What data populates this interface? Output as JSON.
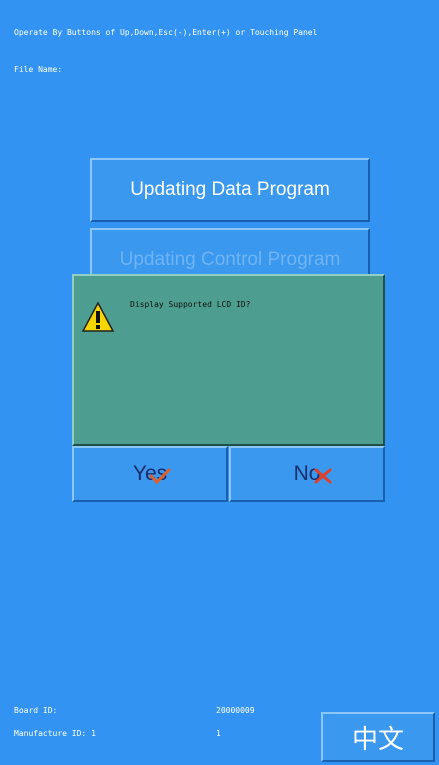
{
  "header": {
    "instruction": "Operate By Buttons of Up,Down,Esc(-),Enter(+) or Touching Panel",
    "file_name_label": "File Name:"
  },
  "menu": {
    "items": [
      {
        "label": "Updating Data Program"
      },
      {
        "label": "Updating Control Program"
      }
    ]
  },
  "dialog": {
    "icon": "warning-icon",
    "message": "Display Supported LCD ID?",
    "yes_label": "Yes",
    "no_label": "No"
  },
  "footer": {
    "board_id_label": "Board ID:",
    "board_id_value": "20000009",
    "manufacture_id_label": "Manufacture ID: 1",
    "manufacture_id_value": "1",
    "language_button": "中文"
  },
  "colors": {
    "background": "#3393f2",
    "dialog": "#4d9e90",
    "button_text_dark": "#1c2d6b",
    "yes_check": "#e0602a",
    "no_cross": "#e0402a"
  }
}
